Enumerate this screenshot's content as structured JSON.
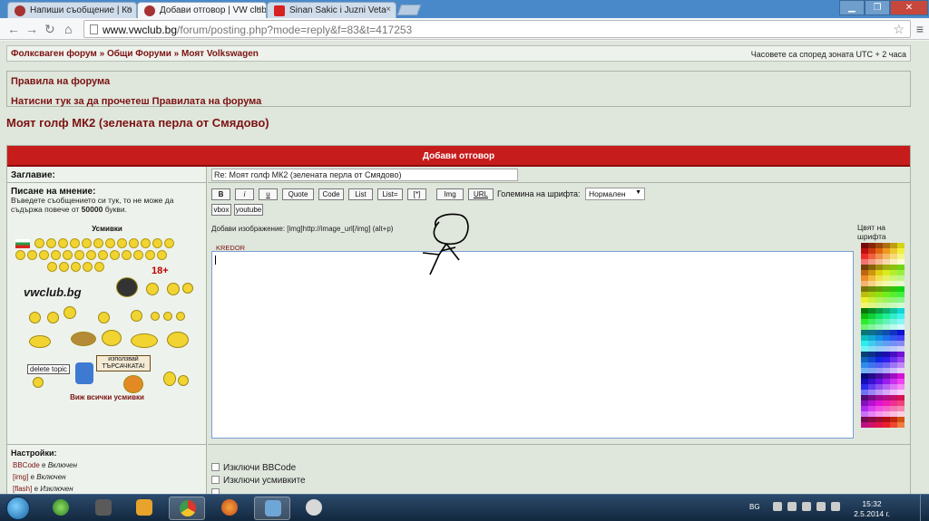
{
  "browser": {
    "tabs": [
      {
        "label": "Напиши съобщение | Ко",
        "active": false
      },
      {
        "label": "Добави отговор | VW club",
        "active": true
      },
      {
        "label": "Sinan Sakic i Juzni Veta",
        "active": false
      }
    ],
    "url_host": "www.vwclub.bg",
    "url_path": "/forum/posting.php?mode=reply&f=83&t=417253"
  },
  "forum": {
    "breadcrumb": [
      "Фолксваген форум",
      "Общи Форуми",
      "Моят Volkswagen"
    ],
    "breadcrumb_sep": "»",
    "timezone": "Часовете са според зоната UTC + 2 часа",
    "rules_title": "Правила на форума",
    "rules_link": "Натисни тук за да прочетеш Правилата на форума",
    "topic_title": "Моят голф МК2 (зелената перла от Смядово)"
  },
  "form": {
    "header": "Добави отговор",
    "subject_label": "Заглавие:",
    "subject_value": "Re: Моят голф МК2 (зелената перла от Смядово)",
    "message_label": "Писане на мнение:",
    "message_hint_prefix": "Въведете съобщението си тук, то не може да съдържа повече от",
    "message_hint_limit": "50000",
    "message_hint_suffix": "букви.",
    "smilies_title": "Усмивки",
    "smilies_see_all": "Виж всички усмивки",
    "sign_text": "използвай ТЪРСАЧКАТА!",
    "delete_topic": "delete topic",
    "badge_18": "18+",
    "logo_text": "vwclub.bg",
    "bbcode_buttons": [
      "B",
      "i",
      "u",
      "Quote",
      "Code",
      "List",
      "List=",
      "[*]",
      "Img",
      "URL"
    ],
    "extra_buttons": [
      "vbox",
      "youtube"
    ],
    "fontsize_label": "Големина на шрифта:",
    "fontsize_value": "Нормален",
    "helpline": "Добави изображение: [img]http://image_url[/img]  (alt+p)",
    "kredor": "KREDOR",
    "color_label": "Цвят на шрифта",
    "settings_label": "Настройки:",
    "settings": [
      {
        "name": "BBCode",
        "text": "е",
        "state": "Включен"
      },
      {
        "name": "[img]",
        "text": "е",
        "state": "Включен"
      },
      {
        "name": "[flash]",
        "text": "е",
        "state": "Изключен"
      }
    ],
    "options": [
      "Изключи BBCode",
      "Изключи усмивките"
    ]
  },
  "taskbar": {
    "language": "BG",
    "time": "15:32",
    "date": "2.5.2014 г."
  },
  "accent_colors": {
    "forum_red": "#c71c1c",
    "link_dark_red": "#7b1212",
    "page_bg": "#dfe6dc"
  }
}
